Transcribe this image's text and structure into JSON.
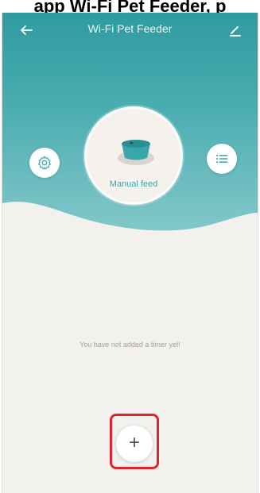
{
  "caption": {
    "text": "app Wi-Fi Pet Feeder, p"
  },
  "app": {
    "title": "Wi-Fi Pet Feeder",
    "back_icon": "arrow-left-icon",
    "edit_icon": "pencil-icon"
  },
  "feed": {
    "label": "Manual feed",
    "icon": "pet-bowl-icon"
  },
  "buttons": {
    "settings_icon": "gear-icon",
    "list_icon": "list-icon",
    "add_label": "+"
  },
  "timers": {
    "empty_message": "You have not added a timer yet!"
  },
  "colors": {
    "header_top": "#2f9ba1",
    "header_bottom": "#86c9cb",
    "accent": "#3aa6ab",
    "background": "#f3f1ee",
    "highlight": "#e0242b"
  }
}
